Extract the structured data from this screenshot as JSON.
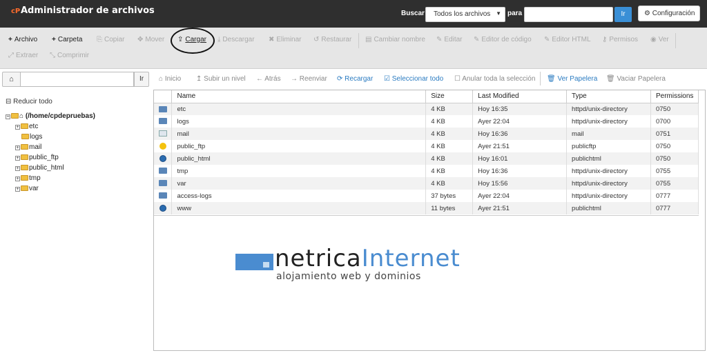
{
  "header": {
    "logo": "cP",
    "title": "Administrador de archivos",
    "search_label": "Buscar",
    "search_scope": "Todos los archivos",
    "para_label": "para",
    "search_value": "",
    "go_label": "Ir",
    "config_label": "Configuración"
  },
  "toolbar": {
    "archivo": "Archivo",
    "carpeta": "Carpeta",
    "copiar": "Copiar",
    "mover": "Mover",
    "cargar": "Cargar",
    "descargar": "Descargar",
    "eliminar": "Eliminar",
    "restaurar": "Restaurar",
    "cambiar_nombre": "Cambiar nombre",
    "editar": "Editar",
    "editor_codigo": "Editor de código",
    "editor_html": "Editor HTML",
    "permisos": "Permisos",
    "ver": "Ver",
    "extraer": "Extraer",
    "comprimir": "Comprimir"
  },
  "pathbar": {
    "value": "",
    "go_label": "Ir"
  },
  "nav": {
    "inicio": "Inicio",
    "subir": "Subir un nivel",
    "atras": "Atrás",
    "reenviar": "Reenviar",
    "recargar": "Recargar",
    "seleccionar": "Seleccionar todo",
    "anular": "Anular toda la selección",
    "ver_papelera": "Ver Papelera",
    "vaciar_papelera": "Vaciar Papelera"
  },
  "tree": {
    "collapse_label": "Reducir todo",
    "root": "(/home/cpdepruebas)",
    "items": [
      "etc",
      "logs",
      "mail",
      "public_ftp",
      "public_html",
      "tmp",
      "var"
    ]
  },
  "table": {
    "columns": [
      "Name",
      "Size",
      "Last Modified",
      "Type",
      "Permissions"
    ],
    "rows": [
      {
        "icon": "folder-icon",
        "name": "etc",
        "size": "4 KB",
        "modified": "Hoy 16:35",
        "type": "httpd/unix-directory",
        "perms": "0750"
      },
      {
        "icon": "folder-icon",
        "name": "logs",
        "size": "4 KB",
        "modified": "Ayer 22:04",
        "type": "httpd/unix-directory",
        "perms": "0700"
      },
      {
        "icon": "mail-icon",
        "name": "mail",
        "size": "4 KB",
        "modified": "Hoy 16:36",
        "type": "mail",
        "perms": "0751"
      },
      {
        "icon": "ftp-icon",
        "name": "public_ftp",
        "size": "4 KB",
        "modified": "Ayer 21:51",
        "type": "publicftp",
        "perms": "0750"
      },
      {
        "icon": "globe-icon",
        "name": "public_html",
        "size": "4 KB",
        "modified": "Hoy 16:01",
        "type": "publichtml",
        "perms": "0750"
      },
      {
        "icon": "folder-icon",
        "name": "tmp",
        "size": "4 KB",
        "modified": "Hoy 16:36",
        "type": "httpd/unix-directory",
        "perms": "0755"
      },
      {
        "icon": "folder-icon",
        "name": "var",
        "size": "4 KB",
        "modified": "Hoy 15:56",
        "type": "httpd/unix-directory",
        "perms": "0755"
      },
      {
        "icon": "folder-icon",
        "name": "access-logs",
        "size": "37 bytes",
        "modified": "Ayer 22:04",
        "type": "httpd/unix-directory",
        "perms": "0777"
      },
      {
        "icon": "globe-icon",
        "name": "www",
        "size": "11 bytes",
        "modified": "Ayer 21:51",
        "type": "publichtml",
        "perms": "0777"
      }
    ]
  },
  "watermark": {
    "brand_a": "netrica",
    "brand_b": "Internet",
    "tagline": "alojamiento web y dominios"
  },
  "colors": {
    "header_bg": "#2f2f2f",
    "accent": "#3a8fd6",
    "logo_orange": "#ff6c2c",
    "link_blue": "#2a7bc1"
  }
}
